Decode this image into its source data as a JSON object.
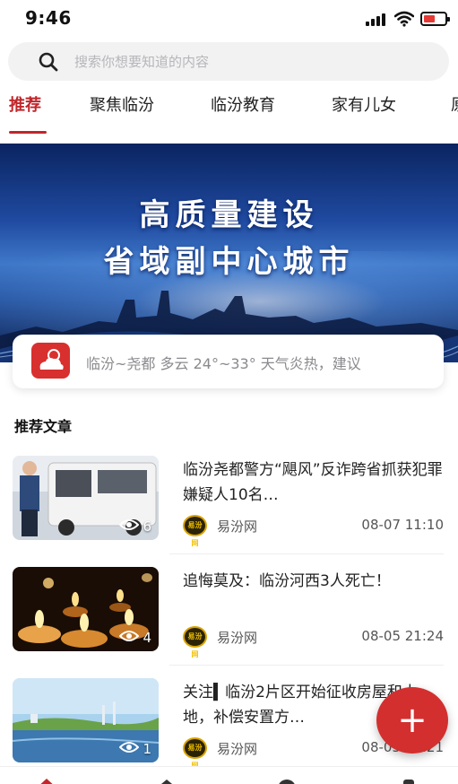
{
  "status_bar": {
    "time": "9:46"
  },
  "search": {
    "placeholder": "搜索你想要知道的内容",
    "icon": "search-icon"
  },
  "tabs": [
    {
      "label": "推荐",
      "active": true
    },
    {
      "label": "聚焦临汾"
    },
    {
      "label": "临汾教育"
    },
    {
      "label": "家有儿女"
    },
    {
      "label": "原"
    }
  ],
  "banner": {
    "line1": "高质量建设",
    "line2": "省域副中心城市"
  },
  "weather": {
    "text": "临汾~尧都 多云 24°~33° 天气炎热，建议",
    "icon": "weather-cloudy-icon",
    "icon_color": "#d8302e"
  },
  "section": {
    "title": "推荐文章"
  },
  "articles": [
    {
      "title": "临汾尧都警方“飓风”反诈跨省抓获犯罪嫌疑人10名…",
      "source": "易汾网",
      "date": "08-07 11:10",
      "views": "6",
      "logo_text": "易汾网"
    },
    {
      "title": "追悔莫及：临汾河西3人死亡！",
      "source": "易汾网",
      "date": "08-05 21:24",
      "views": "4",
      "logo_text": "易汾网"
    },
    {
      "title": "关注▍临汾2片区开始征收房屋和土地，补偿安置方…",
      "source": "易汾网",
      "date": "08-05 21:21",
      "views": "1",
      "logo_text": "易汾网"
    }
  ],
  "fab": {
    "label": "+"
  },
  "colors": {
    "accent": "#c0262b",
    "fab": "#d32f2f"
  }
}
